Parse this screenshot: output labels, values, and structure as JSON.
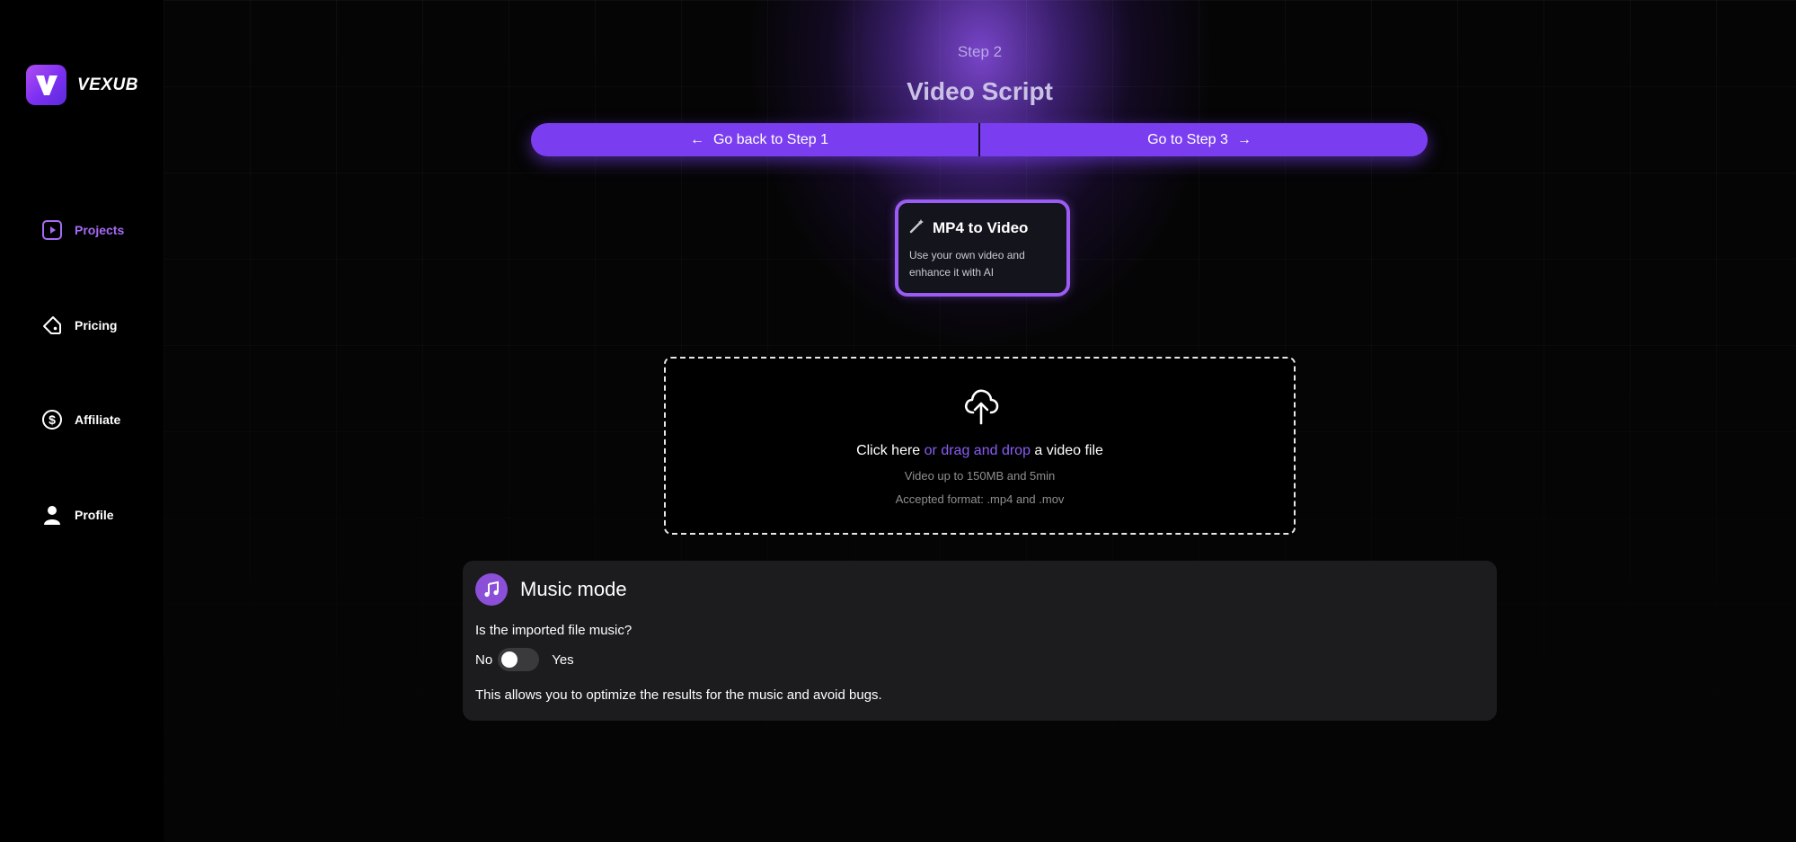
{
  "brand": {
    "name": "VEXUB"
  },
  "sidebar": {
    "items": [
      {
        "label": "Projects",
        "icon": "play-square-icon",
        "active": true
      },
      {
        "label": "Pricing",
        "icon": "tag-icon",
        "active": false
      },
      {
        "label": "Affiliate",
        "icon": "dollar-circle-icon",
        "active": false
      },
      {
        "label": "Profile",
        "icon": "user-icon",
        "active": false
      }
    ]
  },
  "header": {
    "step": "Step 2",
    "title": "Video Script"
  },
  "stepper": {
    "back_label": "Go back to Step 1",
    "next_label": "Go to Step 3"
  },
  "mode_card": {
    "title": "MP4 to Video",
    "description_line1": "Use your own video and",
    "description_line2": "enhance it with AI",
    "icon": "magic-wand-icon"
  },
  "dropzone": {
    "click_text": "Click here",
    "link_text": "or drag and drop",
    "rest_text": "a video file",
    "limit": "Video up to 150MB and 5min",
    "formats": "Accepted format: .mp4 and .mov"
  },
  "music_mode": {
    "title": "Music mode",
    "question": "Is the imported file music?",
    "no_label": "No",
    "yes_label": "Yes",
    "toggle_on": false,
    "note": "This allows you to optimize the results for the music and avoid bugs."
  },
  "colors": {
    "accent": "#7a3ef0",
    "active_nav": "#a66bf5",
    "link": "#8a5cf5",
    "card_bg": "#1c1c1e"
  }
}
